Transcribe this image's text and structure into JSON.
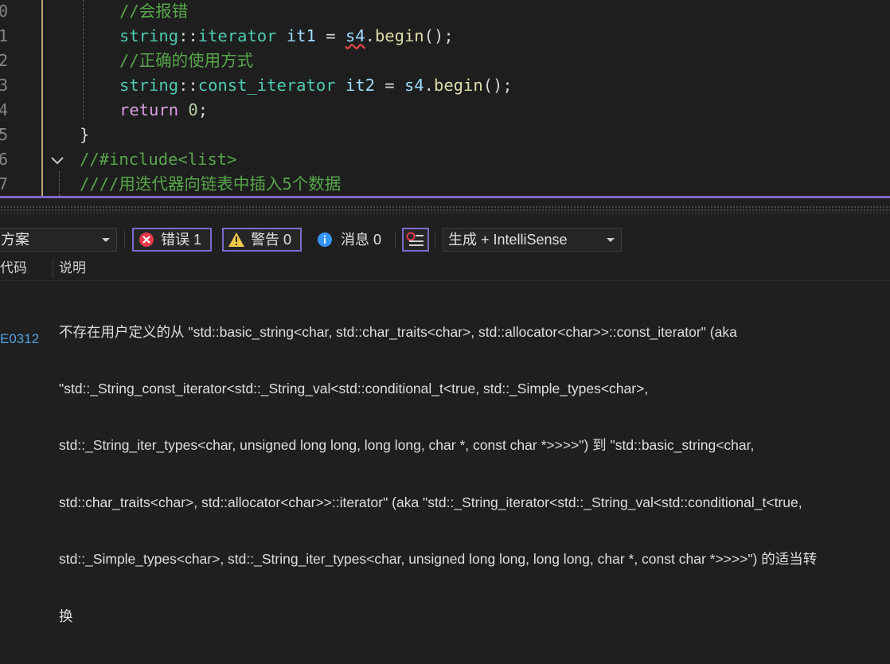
{
  "editor": {
    "lines": [
      {
        "num": "0",
        "tokens": [
          {
            "t": "//会报错",
            "c": "comment"
          }
        ]
      },
      {
        "num": "1",
        "tokens": [
          {
            "t": "string",
            "c": "type"
          },
          {
            "t": "::",
            "c": "op"
          },
          {
            "t": "iterator",
            "c": "type"
          },
          {
            "t": " it1 ",
            "c": "var"
          },
          {
            "t": "= ",
            "c": "op"
          },
          {
            "t": "s4",
            "c": "var",
            "squiggle": true
          },
          {
            "t": ".",
            "c": "op"
          },
          {
            "t": "begin",
            "c": "fn"
          },
          {
            "t": "();",
            "c": "op"
          }
        ]
      },
      {
        "num": "2",
        "tokens": [
          {
            "t": "//正确的使用方式",
            "c": "comment"
          }
        ]
      },
      {
        "num": "3",
        "tokens": [
          {
            "t": "string",
            "c": "type"
          },
          {
            "t": "::",
            "c": "op"
          },
          {
            "t": "const_iterator",
            "c": "type"
          },
          {
            "t": " it2 ",
            "c": "var"
          },
          {
            "t": "= ",
            "c": "op"
          },
          {
            "t": "s4",
            "c": "var"
          },
          {
            "t": ".",
            "c": "op"
          },
          {
            "t": "begin",
            "c": "fn"
          },
          {
            "t": "();",
            "c": "op"
          }
        ]
      },
      {
        "num": "4",
        "tokens": [
          {
            "t": "return",
            "c": "kw"
          },
          {
            "t": " ",
            "c": "op"
          },
          {
            "t": "0",
            "c": "num"
          },
          {
            "t": ";",
            "c": "op"
          }
        ]
      },
      {
        "num": "5",
        "tokens": [
          {
            "t": "}",
            "c": "op"
          }
        ]
      },
      {
        "num": "6",
        "tokens": [
          {
            "t": "//#include<list>",
            "c": "comment"
          }
        ]
      },
      {
        "num": "7",
        "tokens": [
          {
            "t": "////用迭代器向链表中插入5个数据",
            "c": "comment"
          }
        ]
      }
    ]
  },
  "error_list": {
    "scope_label": "方案",
    "errors_label": "错误 1",
    "warnings_label": "警告 0",
    "messages_label": "消息 0",
    "build_filter_label": "生成 + IntelliSense",
    "col_code": "代码",
    "col_desc": "说明",
    "error_code": "E0312",
    "error_desc_lines": [
      "不存在用户定义的从 \"std::basic_string<char, std::char_traits<char>, std::allocator<char>>::const_iterator\" (aka",
      "\"std::_String_const_iterator<std::_String_val<std::conditional_t<true, std::_Simple_types<char>,",
      "std::_String_iter_types<char, unsigned long long, long long, char *, const char *>>>>\") 到 \"std::basic_string<char,",
      "std::char_traits<char>, std::allocator<char>>::iterator\" (aka \"std::_String_iterator<std::_String_val<std::conditional_t<true,",
      "std::_Simple_types<char>, std::_String_iter_types<char, unsigned long long, long long, char *, const char *>>>>\") 的适当转",
      "换"
    ]
  },
  "colors": {
    "accent": "#7f68c7",
    "error_icon": "#e5394b",
    "warning_icon": "#f2c94c",
    "info_icon": "#3794ff",
    "error_code": "#4fa3e3"
  }
}
